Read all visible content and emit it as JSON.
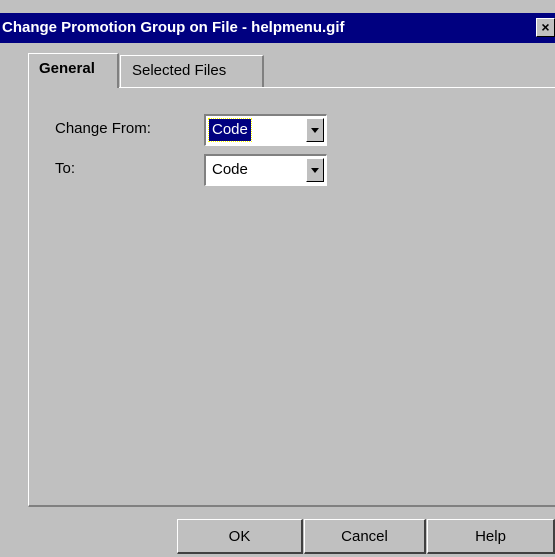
{
  "window": {
    "title": "Change Promotion Group on File - helpmenu.gif",
    "close_glyph": "×"
  },
  "tabs": [
    {
      "label": "General",
      "active": true
    },
    {
      "label": "Selected Files",
      "active": false
    }
  ],
  "form": {
    "change_from_label": "Change From:",
    "change_from_value": "Code",
    "to_label": "To:",
    "to_value": "Code"
  },
  "buttons": {
    "ok": "OK",
    "cancel": "Cancel",
    "help": "Help"
  },
  "colors": {
    "titlebar": "#000080",
    "face": "#c0c0c0",
    "selection": "#000080"
  }
}
